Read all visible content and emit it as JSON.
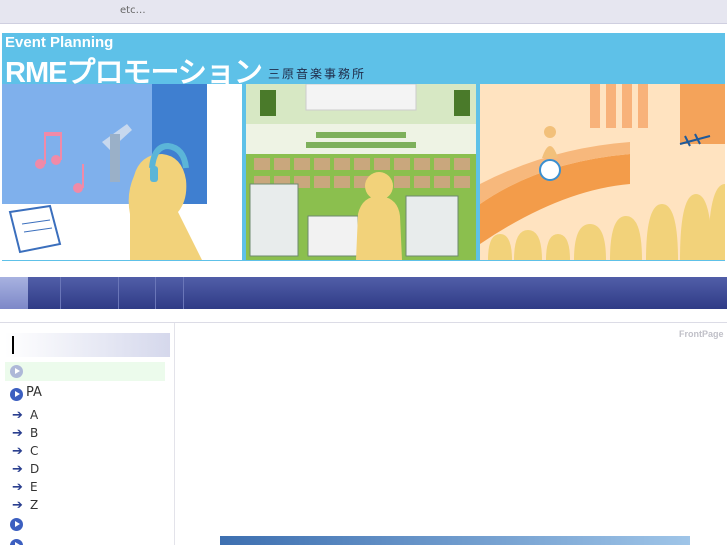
{
  "topbar": {
    "text": "etc…"
  },
  "banner": {
    "subtitle": "Event Planning",
    "title": "RMEプロモーション",
    "company": "三原音楽事務所"
  },
  "sidebar": {
    "items": [
      {
        "label": ""
      },
      {
        "label": "PA"
      }
    ],
    "subitems": [
      "A",
      "B",
      "C",
      "D",
      "E",
      "Z"
    ]
  },
  "main": {
    "page_label": "FrontPage"
  }
}
